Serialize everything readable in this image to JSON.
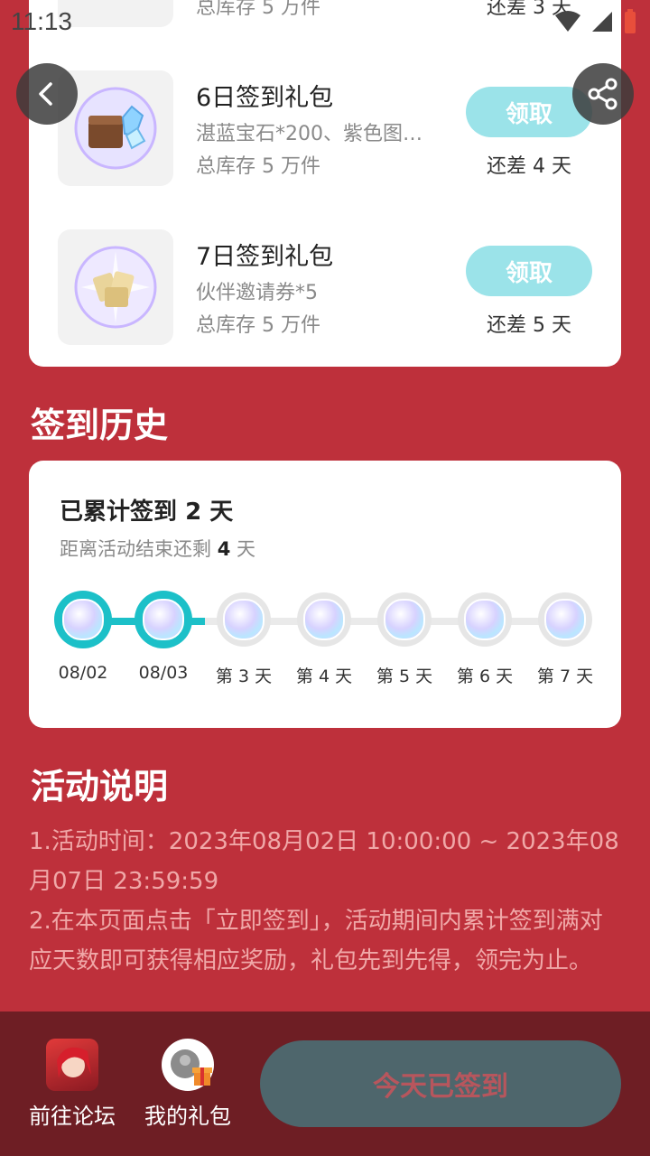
{
  "status_bar": {
    "time": "11:13"
  },
  "gifts": [
    {
      "title": "",
      "desc": "",
      "stock": "总库存 5 万件",
      "days_left": "还差 3 天",
      "claim": ""
    },
    {
      "title": "6日签到礼包",
      "desc": "湛蓝宝石*200、紫色图…",
      "stock": "总库存 5 万件",
      "days_left": "还差 4 天",
      "claim": "领取"
    },
    {
      "title": "7日签到礼包",
      "desc": "伙伴邀请券*5",
      "stock": "总库存 5 万件",
      "days_left": "还差 5 天",
      "claim": "领取"
    }
  ],
  "history": {
    "section_title": "签到历史",
    "cumulative_prefix": "已累计签到",
    "cumulative_days": "2",
    "cumulative_suffix": "天",
    "remaining_prefix": "距离活动结束还剩",
    "remaining_days": "4",
    "remaining_suffix": "天",
    "days": [
      {
        "label": "08/02",
        "done": true
      },
      {
        "label": "08/03",
        "done": true
      },
      {
        "label": "第 3 天",
        "done": false
      },
      {
        "label": "第 4 天",
        "done": false
      },
      {
        "label": "第 5 天",
        "done": false
      },
      {
        "label": "第 6 天",
        "done": false
      },
      {
        "label": "第 7 天",
        "done": false
      }
    ]
  },
  "rules": {
    "section_title": "活动说明",
    "line1": "1.活动时间：2023年08月02日 10:00:00 ~ 2023年08月07日 23:59:59",
    "line2": "2.在本页面点击「立即签到」，活动期间内累计签到满对应天数即可获得相应奖励，礼包先到先得，领完为止。"
  },
  "bottom_bar": {
    "forum_label": "前往论坛",
    "gifts_label": "我的礼包",
    "checkin_label": "今天已签到"
  },
  "icons": {
    "back": "chevron-left-icon",
    "share": "share-icon"
  },
  "colors": {
    "background": "#be303b",
    "claim_button": "#9be3e9",
    "progress": "#1cc0c8",
    "bottom_bar": "#6e1e24",
    "checkin_button": "#4e666c"
  }
}
